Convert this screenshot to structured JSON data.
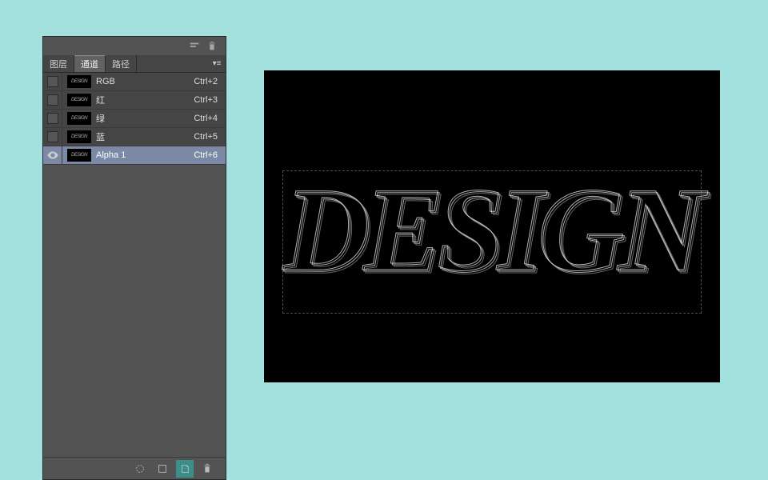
{
  "panel": {
    "tabs": [
      "图层",
      "通道",
      "路径"
    ],
    "activeTab": 1,
    "channels": [
      {
        "name": "RGB",
        "key": "Ctrl+2",
        "visible": false,
        "selected": false,
        "thumb": "DESIGN"
      },
      {
        "name": "红",
        "key": "Ctrl+3",
        "visible": false,
        "selected": false,
        "thumb": "DESIGN"
      },
      {
        "name": "绿",
        "key": "Ctrl+4",
        "visible": false,
        "selected": false,
        "thumb": "DESIGN"
      },
      {
        "name": "蓝",
        "key": "Ctrl+5",
        "visible": false,
        "selected": false,
        "thumb": "DESIGN"
      },
      {
        "name": "Alpha 1",
        "key": "Ctrl+6",
        "visible": true,
        "selected": true,
        "thumb": "DESIGN"
      }
    ],
    "footer_highlight_index": 2
  },
  "canvas": {
    "text": "DESIGN"
  }
}
